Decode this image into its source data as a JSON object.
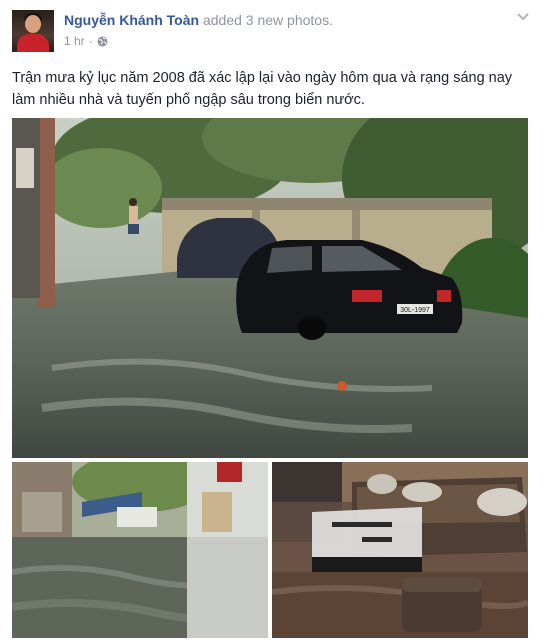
{
  "post": {
    "author": "Nguyễn Khánh Toàn",
    "action": "added 3 new photos.",
    "action_count": "3",
    "time": "1 hr",
    "dot": "·",
    "caption": "Trận mưa kỷ lục năm 2008 đã xác lập lại vào ngày hôm qua và rạng sáng nay làm nhiều nhà và tuyến phố ngập sâu trong biển nước."
  },
  "photos": {
    "main_plate": "30L-1997"
  },
  "icons": {
    "privacy": "globe-icon",
    "menu": "chevron-down-icon"
  },
  "colors": {
    "author_link": "#365899",
    "meta_text": "#90949c",
    "body_text": "#1d2129"
  }
}
